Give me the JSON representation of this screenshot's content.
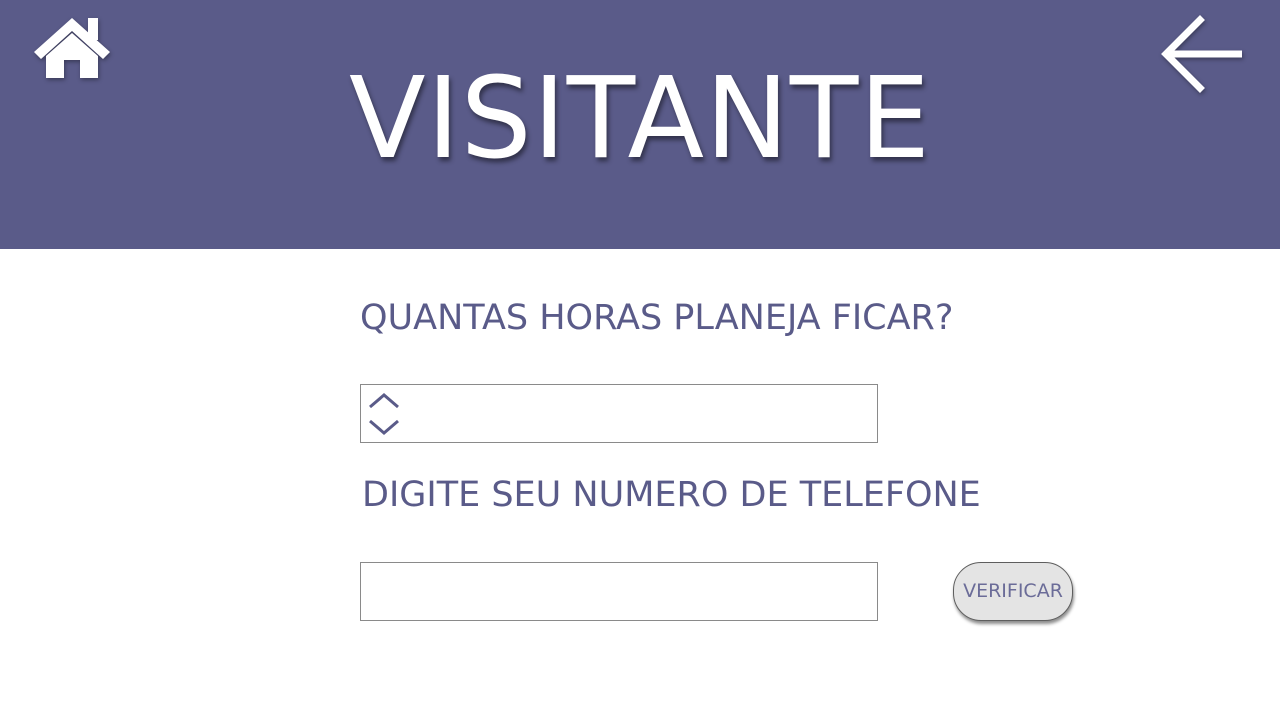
{
  "header": {
    "title": "VISITANTE",
    "home_icon": "home-icon",
    "back_icon": "arrow-left-icon",
    "background_color": "#5a5b89"
  },
  "form": {
    "hours": {
      "label": "QUANTAS HORAS PLANEJA FICAR?",
      "value": "",
      "up_icon": "chevron-up-icon",
      "down_icon": "chevron-down-icon"
    },
    "phone": {
      "label": "DIGITE SEU NUMERO DE TELEFONE",
      "value": ""
    },
    "verify_label": "VERIFICAR"
  },
  "colors": {
    "accent": "#5a5b89",
    "text_on_accent": "#ffffff",
    "button_bg": "#e4e4e4"
  }
}
